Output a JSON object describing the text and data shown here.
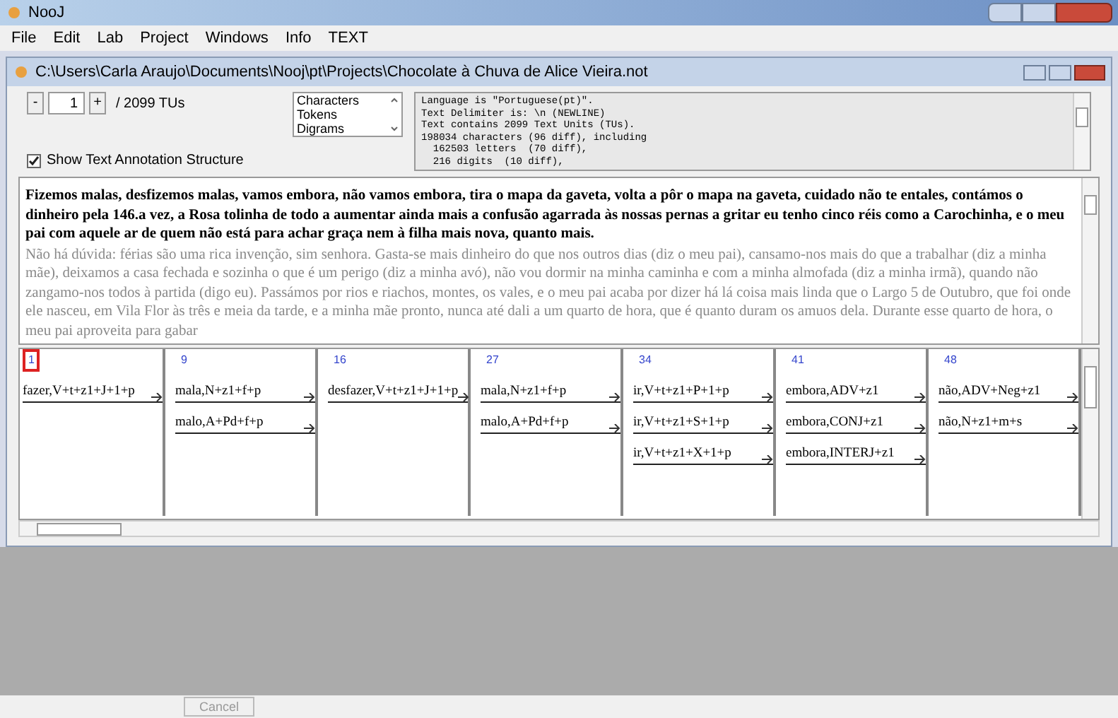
{
  "window": {
    "title": "NooJ"
  },
  "menu": [
    "File",
    "Edit",
    "Lab",
    "Project",
    "Windows",
    "Info",
    "TEXT"
  ],
  "document": {
    "title": "C:\\Users\\Carla Araujo\\Documents\\Nooj\\pt\\Projects\\Chocolate à Chuva de Alice Vieira.not",
    "tu_field": {
      "value": "1"
    },
    "minus": "-",
    "plus": "+",
    "tu_total": "/ 2099 TUs",
    "list": [
      {
        "label": "Characters",
        "selected": false
      },
      {
        "label": "Tokens",
        "selected": false
      },
      {
        "label": "Digrams",
        "selected": false
      }
    ],
    "info": [
      "Language is \"Portuguese(pt)\".",
      "Text Delimiter is: \\n (NEWLINE)",
      "Text contains 2099 Text Units (TUs).",
      "198034 characters (96 diff), including",
      "  162503 letters  (70 diff),",
      "  216 digits  (10 diff),"
    ],
    "show_annotation": {
      "label": "Show Text Annotation Structure",
      "checked": true
    },
    "paragraphs": [
      {
        "kind": "current",
        "text": "Fizemos malas, desfizemos malas, vamos embora, não vamos embora, tira o mapa da gaveta, volta a pôr o mapa na gaveta, cuidado não te entales, contámos o dinheiro pela 146.a vez, a Rosa tolinha de todo a aumentar ainda mais a confusão agarrada às nossas pernas a gritar eu tenho cinco réis como a Carochinha, e o meu pai com aquele ar de quem não está para achar graça nem à filha mais nova, quanto mais."
      },
      {
        "kind": "next",
        "text": "Não há dúvida: férias são uma rica invenção, sim senhora. Gasta-se mais dinheiro do que nos outros dias (diz o meu pai), cansamo-nos mais do que a trabalhar (diz a minha mãe), deixamos a casa fechada e sozinha o que é um perigo (diz a minha avó), não vou dormir na minha caminha e com a minha almofada (diz a minha irmã), quando não zangamo-nos todos à partida (digo eu). Passámos por rios e riachos, montes, os vales, e o meu pai acaba por dizer há lá coisa mais linda que o Largo 5 de Outubro, que foi onde ele nasceu, em Vila Flor às três e meia da tarde, e a minha mãe pronto, nunca até dali a um quarto de hora, que é quanto duram os amuos dela. Durante esse quarto de hora, o meu pai aproveita para gabar"
      }
    ],
    "columns": [
      {
        "number": "1",
        "selected": true,
        "entries": [
          "fazer,V+t+z1+J+1+p"
        ]
      },
      {
        "number": "9",
        "selected": false,
        "entries": [
          "mala,N+z1+f+p",
          "malo,A+Pd+f+p"
        ]
      },
      {
        "number": "16",
        "selected": false,
        "entries": [
          "desfazer,V+t+z1+J+1+p"
        ]
      },
      {
        "number": "27",
        "selected": false,
        "entries": [
          "mala,N+z1+f+p",
          "malo,A+Pd+f+p"
        ]
      },
      {
        "number": "34",
        "selected": false,
        "entries": [
          "ir,V+t+z1+P+1+p",
          "ir,V+t+z1+S+1+p",
          "ir,V+t+z1+X+1+p"
        ]
      },
      {
        "number": "41",
        "selected": false,
        "entries": [
          "embora,ADV+z1",
          "embora,CONJ+z1",
          "embora,INTERJ+z1"
        ]
      },
      {
        "number": "48",
        "selected": false,
        "entries": [
          "não,ADV+Neg+z1",
          "não,N+z1+m+s"
        ]
      }
    ]
  },
  "footer": {
    "cancel": {
      "label": "Cancel",
      "disabled": true
    }
  }
}
